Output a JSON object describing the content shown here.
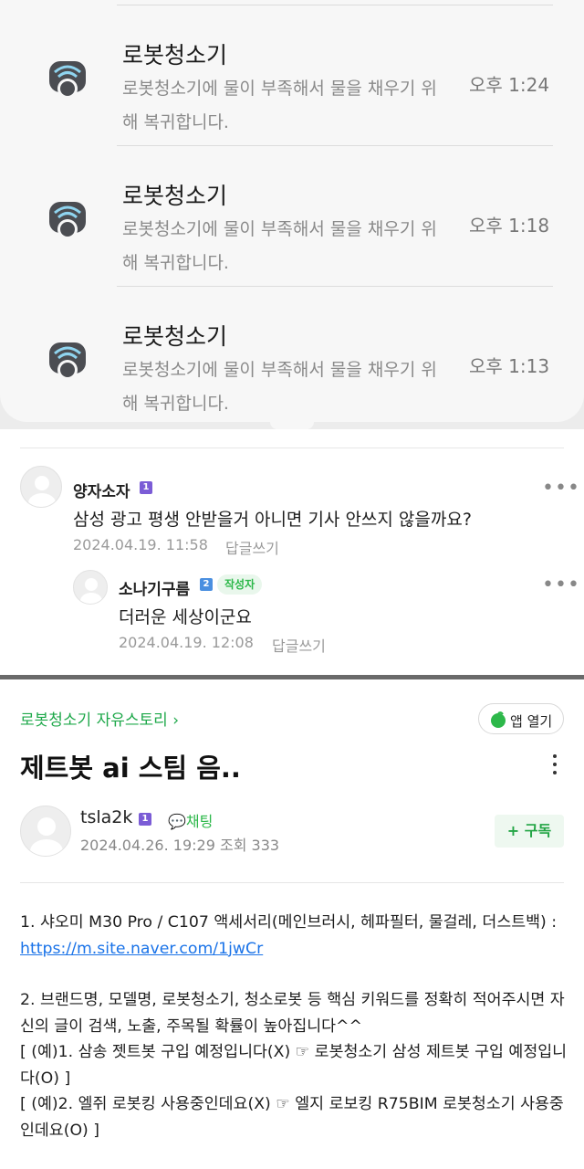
{
  "notifications": [
    {
      "title": "로봇청소기",
      "message": "로봇청소기에 물이 부족해서 물을 채우기 위해 복귀합니다.",
      "time": "오후 1:24"
    },
    {
      "title": "로봇청소기",
      "message": "로봇청소기에 물이 부족해서 물을 채우기 위해 복귀합니다.",
      "time": "오후 1:18"
    },
    {
      "title": "로봇청소기",
      "message": "로봇청소기에 물이 부족해서 물을 채우기 위해 복귀합니다.",
      "time": "오후 1:13"
    }
  ],
  "comments": [
    {
      "author": "양자소자",
      "level": "1",
      "text": "삼성 광고 평생 안받을거 아니면 기사 안쓰지 않을까요?",
      "date": "2024.04.19. 11:58",
      "reply_label": "답글쓰기"
    },
    {
      "author": "소나기구름",
      "level": "2",
      "badge": "작성자",
      "text": "더러운 세상이군요",
      "date": "2024.04.19. 12:08",
      "reply_label": "답글쓰기"
    }
  ],
  "post": {
    "breadcrumb": "로봇청소기 자유스토리 ›",
    "open_app_label": "앱 열기",
    "title": "제트봇 ai 스팀 음..",
    "author": "tsla2k",
    "author_level": "1",
    "chat_label": "채팅",
    "date": "2024.04.26. 19:29",
    "views": "조회 333",
    "subscribe_label": "+ 구독",
    "body": {
      "p1_text": "1. 샤오미 M30 Pro / C107 액세서리(메인브러시, 헤파필터, 물걸레, 더스트백) : ",
      "p1_link": "https://m.site.naver.com/1jwCr",
      "p2": "2. 브랜드명, 모델명, 로봇청소기, 청소로봇 등 핵심 키워드를 정확히 적어주시면 자신의 글이 검색, 노출, 주목될 확률이 높아집니다^^",
      "p3": "[ (예)1. 삼송 젯트봇 구입 예정입니다(X) ☞ 로봇청소기 삼성 제트봇 구입 예정입니다(O) ]",
      "p4": "[ (예)2. 엘쥐 로봇킹 사용중인데요(X) ☞ 엘지 로보킹 R75BIM 로봇청소기 사용중인데요(O) ]"
    }
  },
  "colors": {
    "accent_green": "#2db84a",
    "link_blue": "#1a73e8",
    "level1_badge": "#7b5cd6",
    "level2_badge": "#4a8fe0"
  }
}
